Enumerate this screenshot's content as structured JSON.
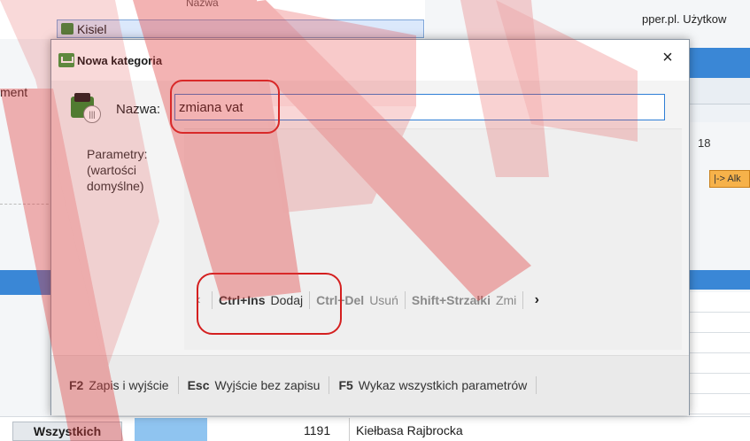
{
  "background": {
    "header_col": "Nazwa",
    "selected_row": "Kisiel",
    "right_top_text": "pper.pl. Użytkow",
    "right_number": "18",
    "right_button": "|-> Alk",
    "left_text": "ment",
    "tab_all": "Wszystkich",
    "row": {
      "number": "1191",
      "name": "Kiełbasa Rajbrocka"
    }
  },
  "dialog": {
    "title": "Nowa kategoria",
    "close": "×",
    "name_label": "Nazwa:",
    "name_value": "zmiana vat",
    "params_label": "Parametry:\n(wartości\ndomyślne)",
    "toolbar": {
      "left_arrow": "‹",
      "right_arrow": "›",
      "items": [
        {
          "key": "Ctrl+Ins",
          "label": "Dodaj"
        },
        {
          "key": "Ctrl+Del",
          "label": "Usuń"
        },
        {
          "key": "Shift+Strzałki",
          "label": "Zmi"
        }
      ]
    },
    "footer": [
      {
        "key": "F2",
        "label": "Zapis i wyjście"
      },
      {
        "key": "Esc",
        "label": "Wyjście bez zapisu"
      },
      {
        "key": "F5",
        "label": "Wykaz wszystkich parametrów"
      }
    ]
  },
  "colors": {
    "accent_blue": "#3a87d6",
    "annotation_red": "#d41f1f",
    "watermark_red": "#e23b3b",
    "icon_green": "#3f9a3f"
  }
}
